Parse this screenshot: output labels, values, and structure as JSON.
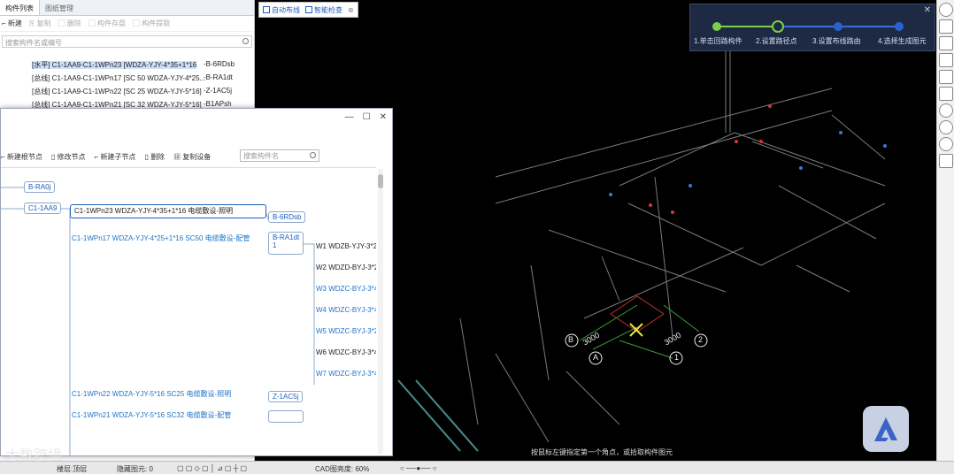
{
  "left_panel": {
    "tabs": [
      "构件列表",
      "图纸管理"
    ],
    "toolbar": [
      {
        "label": "新建",
        "enabled": true
      },
      {
        "label": "复制",
        "enabled": false
      },
      {
        "label": "删除",
        "enabled": false
      },
      {
        "label": "构件存盘",
        "enabled": false
      },
      {
        "label": "构件提取",
        "enabled": false
      }
    ],
    "search_placeholder": "搜索构件名或编号",
    "rows": [
      {
        "text": "[水平] C1-1AA9-C1-1WPn23 [WDZA-YJY-4*35+1*16",
        "code": "-B-6RDsb",
        "selected": true
      },
      {
        "text": "[总线] C1-1AA9-C1-1WPn17 [SC 50 WDZA-YJY-4*25...",
        "code": "-B-RA1dt"
      },
      {
        "text": "[总线] C1-1AA9-C1-1WPn22 [SC 25 WDZA-YJY-5*16]",
        "code": "-Z-1AC5j"
      },
      {
        "text": "[总线] C1-1AA9-C1-1WPn21 [SC 32 WDZA-YJY-5*16]",
        "code": "-B1APsh"
      }
    ]
  },
  "dialog": {
    "toolbar": [
      "新建根节点",
      "修改节点",
      "新建子节点",
      "删除",
      "复制设备"
    ],
    "search_placeholder": "搜索构件名",
    "nodes": {
      "n1": "B-RA0j",
      "n2": "C1-1AA9",
      "main": "C1-1WPn23 WDZA-YJY-4*35+1*16 电缆敷设-照明",
      "main_code": "B-6RDsb",
      "branch": "C1-1WPn17 WDZA-YJY-4*25+1*16 SC50 电缆敷设-配管",
      "branch_code": "B-RA1dt",
      "branch_code_2": "1",
      "n22": "C1-1WPn22 WDZA-YJY-5*16 SC25 电缆敷设-照明",
      "n22_code": "Z-1AC5j",
      "n21": "C1-1WPn21 WDZA-YJY-5*16 SC32 电缆敷设-配管"
    },
    "leaves": [
      {
        "text": "W1 WDZB-YJY-3*2",
        "dark": true
      },
      {
        "text": "W2 WDZD-BYJ-3*2",
        "dark": true
      },
      {
        "text": "W3 WDZC-BYJ-3*4",
        "dark": false
      },
      {
        "text": "W4 WDZC-BYJ-3*4",
        "dark": false
      },
      {
        "text": "W5 WDZC-BYJ-3*2",
        "dark": false
      },
      {
        "text": "W6 WDZC-BYJ-3*4",
        "dark": true
      },
      {
        "text": "W7 WDZC-BYJ-3*4",
        "dark": false
      }
    ]
  },
  "viewport": {
    "mode_tabs": [
      "自动布线",
      "智能检查"
    ],
    "steps": [
      "1.单击回路构件",
      "2.设置路径点",
      "3.设置布线路由",
      "4.选择生成图元"
    ],
    "current_step": 2,
    "notice": "按鼠标左键指定第一个角点，或拾取构件图元",
    "dims": {
      "left": "3000",
      "right": "3000"
    },
    "axis_labels": {
      "b": "B",
      "a": "A",
      "one": "1",
      "two": "2"
    }
  },
  "statusbar": {
    "floor": "楼层:顶层",
    "hidden": "隐藏图元: 0",
    "cad_scale": "CAD图亮度: 60%"
  },
  "watermark": "大数跨境",
  "colors": {
    "accent": "#1d5fbf",
    "step_done": "#7ad04a",
    "step_bg": "#1e2a44"
  }
}
